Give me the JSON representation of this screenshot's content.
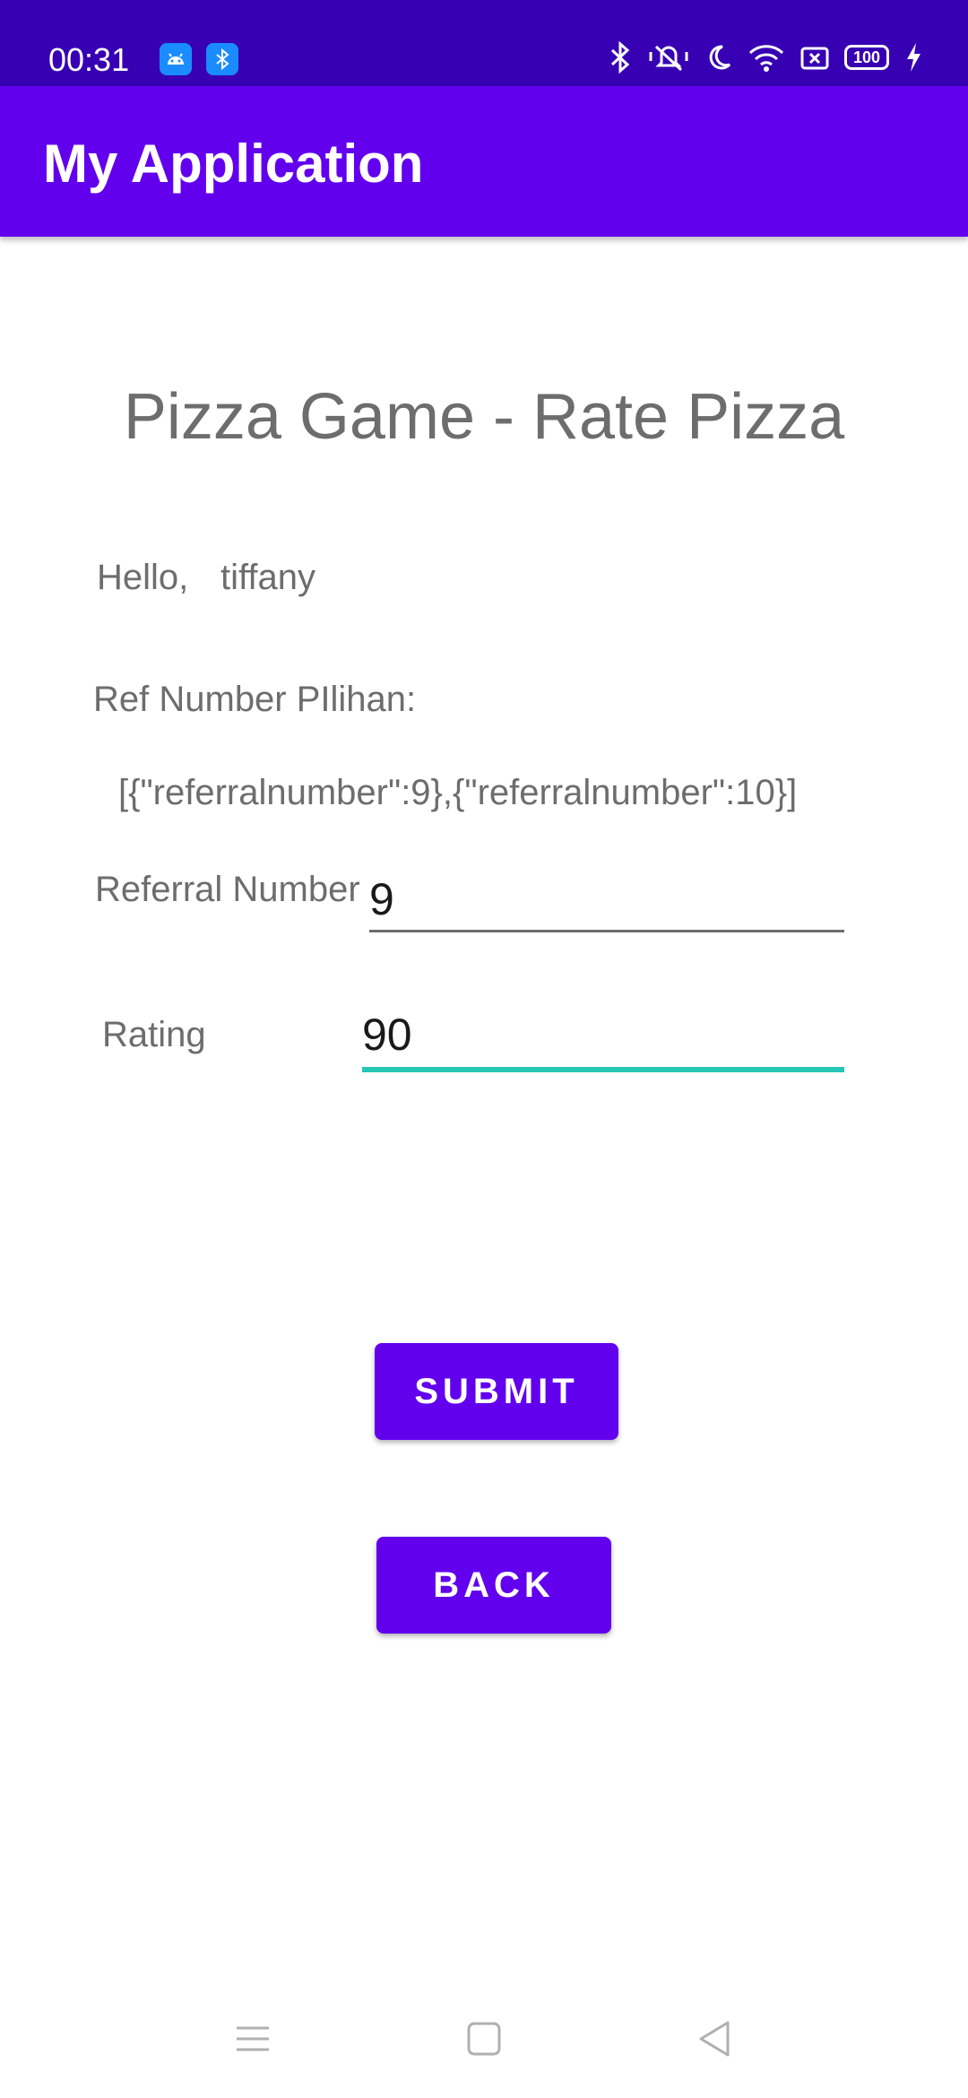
{
  "status_bar": {
    "time": "00:31",
    "battery": "100",
    "icons": [
      "android-notification-icon",
      "bluetooth-notification-icon",
      "bluetooth-icon",
      "vibrate-icon",
      "do-not-disturb-moon-icon",
      "wifi-icon",
      "screen-record-icon",
      "battery-icon",
      "charging-icon"
    ]
  },
  "app_bar": {
    "title": "My Application"
  },
  "main": {
    "page_title": "Pizza Game - Rate Pizza",
    "greeting_prefix": "Hello,",
    "username": "tiffany",
    "ref_heading": "Ref Number PIlihan:",
    "ref_list": "[{\"referralnumber\":9},{\"referralnumber\":10}]",
    "referral_label": "Referral Number",
    "referral_value": "9",
    "rating_label": "Rating",
    "rating_value": "90",
    "submit_label": "SUBMIT",
    "back_label": "BACK"
  },
  "nav_bar": {
    "icons": [
      "menu-icon",
      "home-icon",
      "back-icon"
    ]
  },
  "colors": {
    "status_bar": "#3700b3",
    "app_bar": "#6200ee",
    "button": "#6200ee",
    "focused_underline": "#26c6b5",
    "text_gray": "#6d6d6d"
  }
}
